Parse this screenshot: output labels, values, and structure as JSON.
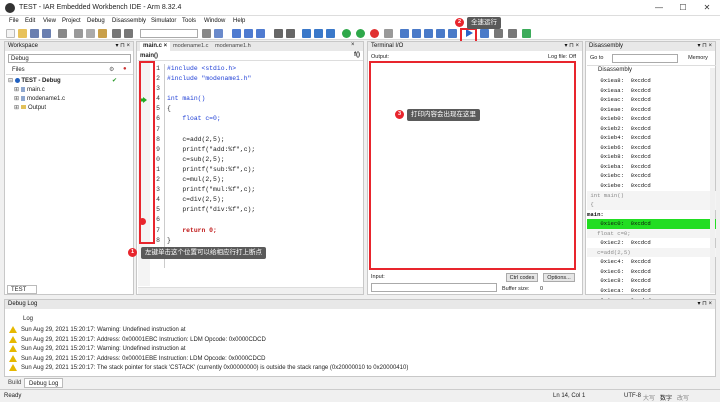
{
  "window": {
    "title": "TEST - IAR Embedded Workbench IDE - Arm 8.32.4",
    "minimize": "—",
    "maximize": "☐",
    "close": "✕"
  },
  "menu": [
    "File",
    "Edit",
    "View",
    "Project",
    "Debug",
    "Disassembly",
    "Simulator",
    "Tools",
    "Window",
    "Help"
  ],
  "workspace": {
    "header": "Workspace",
    "config": "Debug",
    "files_label": "Files",
    "tree": [
      {
        "label": "TEST - Debug",
        "bold": true
      },
      {
        "label": "main.c"
      },
      {
        "label": "modename1.c"
      },
      {
        "label": "Output"
      }
    ],
    "tab": "TEST"
  },
  "editor": {
    "tabs": [
      "main.c",
      "modename1.c",
      "modename1.h"
    ],
    "func_combo": "main()",
    "line_numbers": [
      "1",
      "2",
      "3",
      "4",
      "5",
      "6",
      "7",
      "8",
      "9",
      "0",
      "1",
      "2",
      "3",
      "4",
      "5",
      "6",
      "7",
      "8",
      "9"
    ],
    "lines": [
      "#include <stdio.h>",
      "#include \"modename1.h\"",
      "",
      "int main()",
      "{",
      "    float c=0;",
      "",
      "    c=add(2,5);",
      "    printf(\"add:%f\",c);",
      "    c=sub(2,5);",
      "    printf(\"sub:%f\",c);",
      "    c=mul(2,5);",
      "    printf(\"mul:%f\",c);",
      "    c=div(2,5);",
      "    printf(\"div:%f\",c);",
      "",
      "    return 0;",
      "}",
      ""
    ],
    "breakpoint_line": 17,
    "current_line": 5
  },
  "terminal": {
    "header": "Terminal I/O",
    "output_label": "Output:",
    "logfile": "Log file: Off",
    "input_label": "Input:",
    "ctrl_codes": "Ctrl codes",
    "options": "Options...",
    "buffer_label": "Buffer size:",
    "buffer_value": "0"
  },
  "disassembly": {
    "header": "Disassembly",
    "goto_label": "Go to",
    "memory_btn": "Memory",
    "title": "Disassembly",
    "rows": [
      {
        "text": "    0x1ea8:  0xcdcd",
        "type": "code"
      },
      {
        "text": "    0x1eaa:  0xcdcd",
        "type": "code"
      },
      {
        "text": "    0x1eac:  0xcdcd",
        "type": "code"
      },
      {
        "text": "    0x1eae:  0xcdcd",
        "type": "code"
      },
      {
        "text": "    0x1eb0:  0xcdcd",
        "type": "code"
      },
      {
        "text": "    0x1eb2:  0xcdcd",
        "type": "code"
      },
      {
        "text": "    0x1eb4:  0xcdcd",
        "type": "code"
      },
      {
        "text": "    0x1eb6:  0xcdcd",
        "type": "code"
      },
      {
        "text": "    0x1eb8:  0xcdcd",
        "type": "code"
      },
      {
        "text": "    0x1eba:  0xcdcd",
        "type": "code"
      },
      {
        "text": "    0x1ebc:  0xcdcd",
        "type": "code"
      },
      {
        "text": "    0x1ebe:  0xcdcd",
        "type": "code"
      },
      {
        "text": " int main()",
        "type": "src"
      },
      {
        "text": " {",
        "type": "src"
      },
      {
        "text": "main:",
        "type": "label"
      },
      {
        "text": "    0x1ec0:  0xcdcd",
        "type": "current"
      },
      {
        "text": "   float c=0;",
        "type": "src"
      },
      {
        "text": "    0x1ec2:  0xcdcd",
        "type": "code"
      },
      {
        "text": "   c=add(2,5)",
        "type": "src"
      },
      {
        "text": "    0x1ec4:  0xcdcd",
        "type": "code"
      },
      {
        "text": "    0x1ec6:  0xcdcd",
        "type": "code"
      },
      {
        "text": "    0x1ec8:  0xcdcd",
        "type": "code"
      },
      {
        "text": "    0x1eca:  0xcdcd",
        "type": "code"
      },
      {
        "text": "    0x1ecc:  0xcdcd",
        "type": "code"
      },
      {
        "text": "    0x1ece:  0xcdcd",
        "type": "code"
      }
    ]
  },
  "debuglog": {
    "header": "Debug Log",
    "col": "Log",
    "rows": [
      "Sun Aug 29, 2021 15:20:17: Warning: Undefined instruction at",
      "Sun Aug 29, 2021 15:20:17: Address: 0x00001EBC Instruction: LDM  Opcode: 0x0000CDCD",
      "Sun Aug 29, 2021 15:20:17: Warning: Undefined instruction at",
      "Sun Aug 29, 2021 15:20:17: Address: 0x00001EBE Instruction: LDM  Opcode: 0x0000CDCD",
      "Sun Aug 29, 2021 15:20:17: The stack pointer for stack 'CSTACK' (currently 0x00000000) is outside the stack range (0x20000010 to 0x20000410)"
    ],
    "tabs": [
      "Build",
      "Debug Log"
    ]
  },
  "status": {
    "left": "Ready",
    "pos": "Ln 14, Col 1",
    "enc": "UTF-8",
    "caps": "大写",
    "num": "数字",
    "ovr": "改写"
  },
  "annotations": {
    "one": {
      "num": "1",
      "text": "左键单击这个位置可以给相应行打上断点"
    },
    "two": {
      "num": "2",
      "text": "全速运行"
    },
    "three": {
      "num": "3",
      "text": "打印内容会出现在这里"
    }
  },
  "colors": {
    "accent_red": "#e8252d",
    "current_line": "#22dd22",
    "keyword": "#1f3fd6"
  }
}
